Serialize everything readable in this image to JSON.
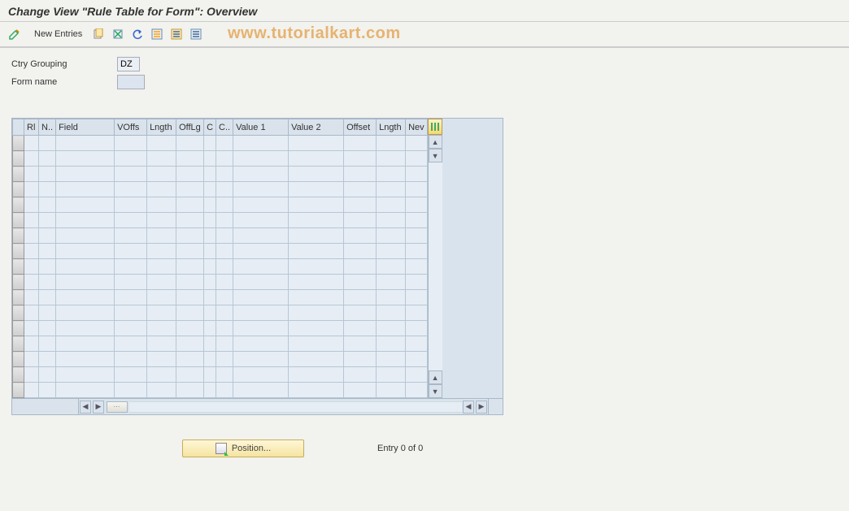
{
  "title": "Change View \"Rule Table for Form\": Overview",
  "toolbar": {
    "new_entries": "New Entries"
  },
  "watermark": "www.tutorialkart.com",
  "fields": {
    "ctry_label": "Ctry Grouping",
    "ctry_value": "DZ",
    "form_label": "Form name",
    "form_value": ""
  },
  "table": {
    "headers": {
      "rl": "Rl",
      "n": "N..",
      "field": "Field",
      "voffs": "VOffs",
      "lngth": "Lngth",
      "offlg": "OffLg",
      "c1": "C",
      "c2": "C..",
      "val1": "Value 1",
      "val2": "Value 2",
      "offset": "Offset",
      "lngth2": "Lngth",
      "new": "Nev"
    }
  },
  "footer": {
    "position": "Position...",
    "entry": "Entry 0 of 0"
  }
}
